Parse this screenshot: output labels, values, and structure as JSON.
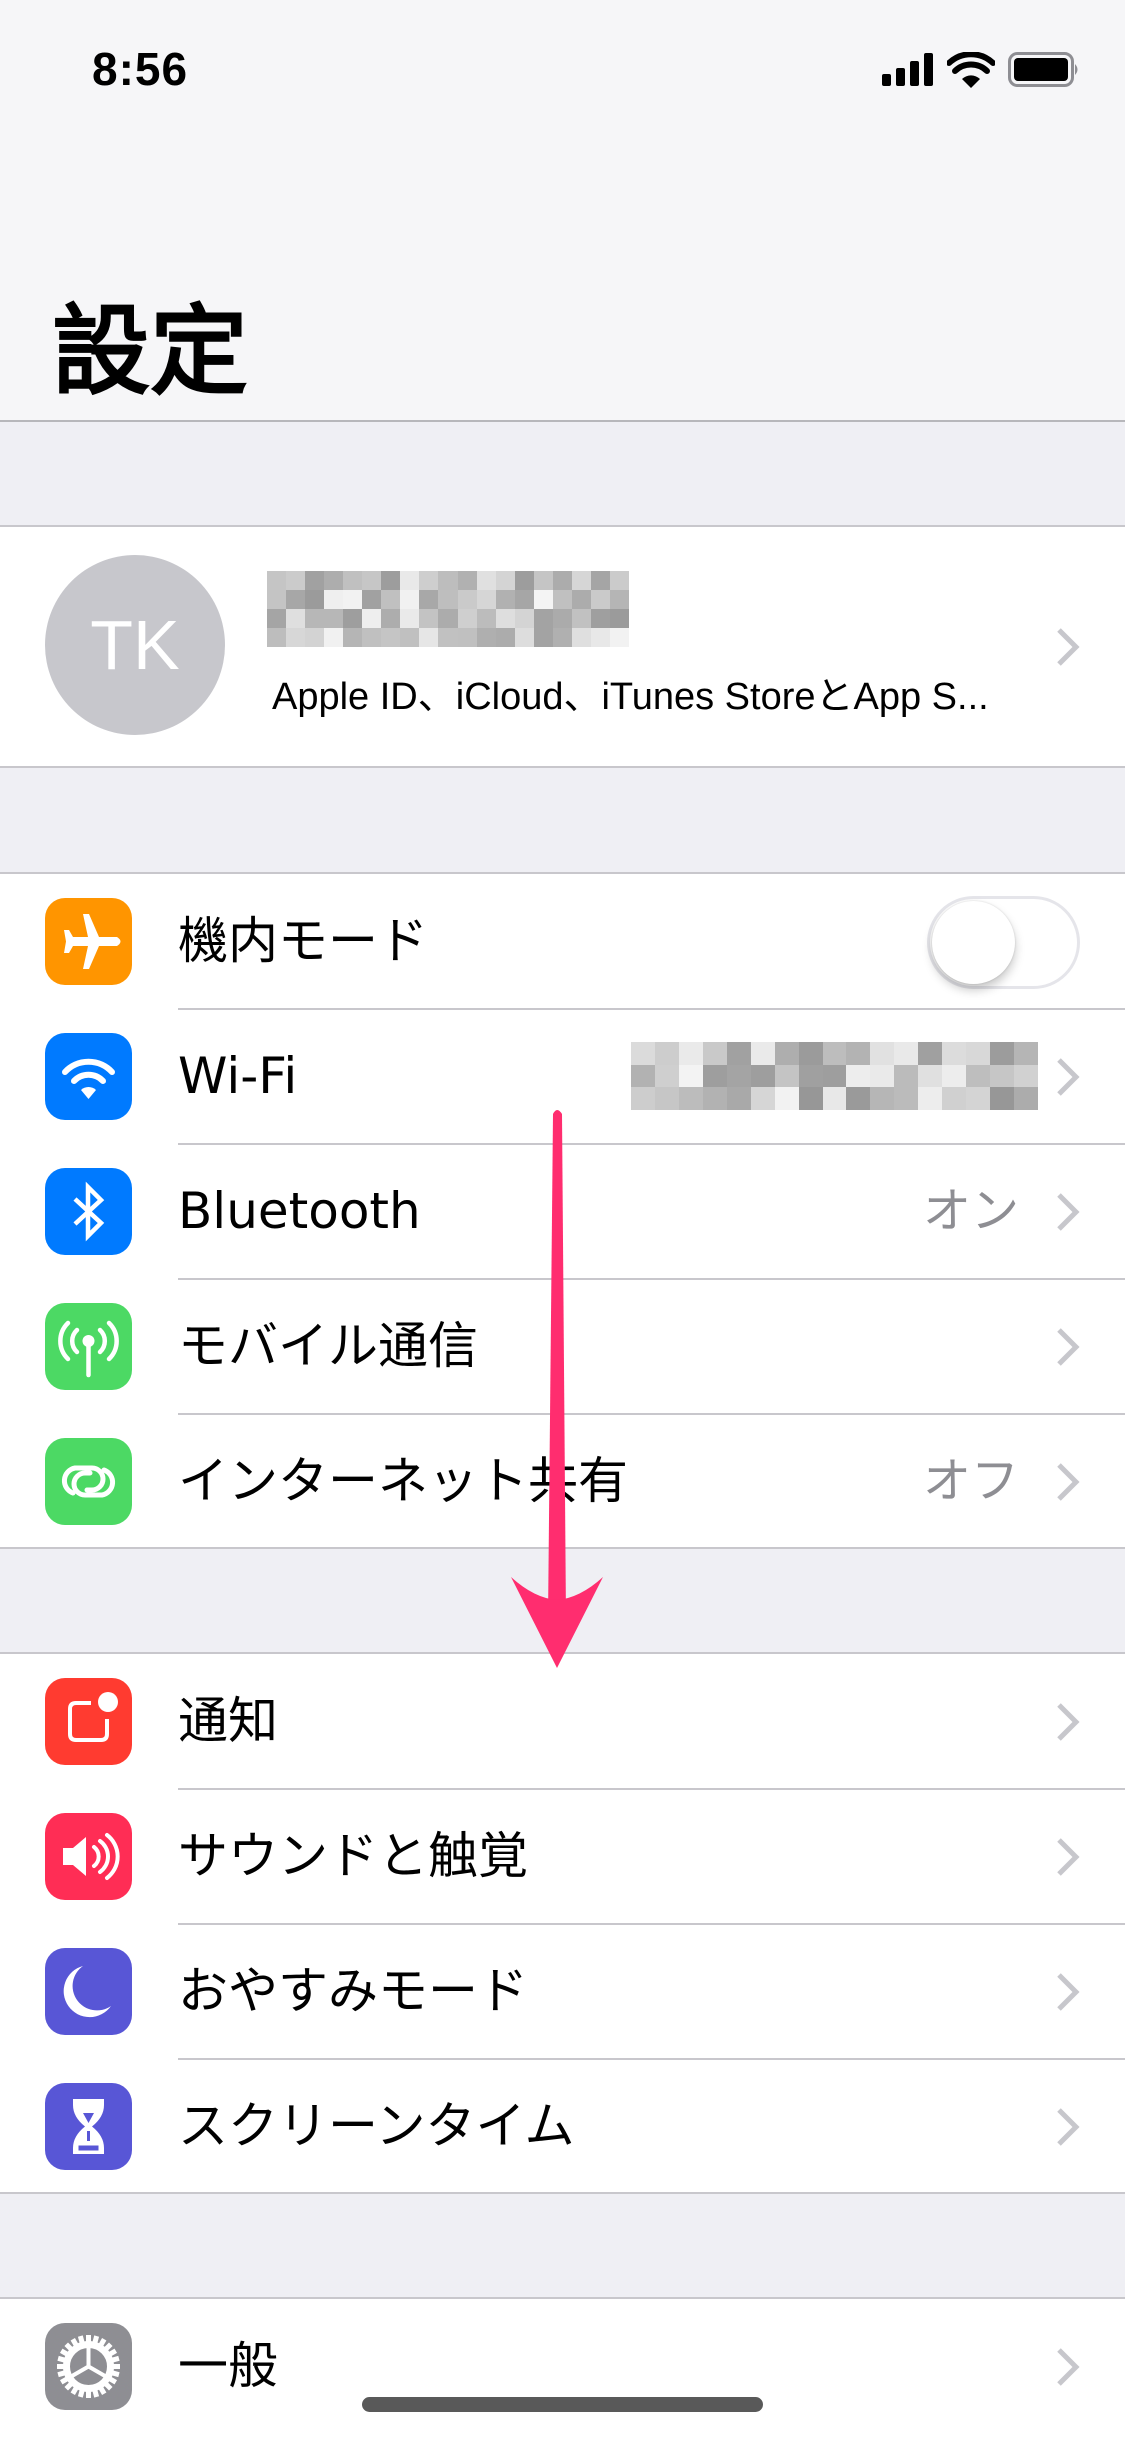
{
  "status_bar": {
    "time": "8:56",
    "signal_icon": "cellular-signal-icon",
    "wifi_icon": "wifi-icon",
    "battery_icon": "battery-full-icon"
  },
  "header": {
    "title": "設定"
  },
  "profile": {
    "initials": "TK",
    "name_redacted": true,
    "subtitle": "Apple ID、iCloud、iTunes StoreとApp S..."
  },
  "sections": [
    {
      "rows": [
        {
          "label": "機内モード",
          "icon": "airplane-icon",
          "color": "#ff9500",
          "control": "toggle",
          "toggle_on": false
        },
        {
          "label": "Wi-Fi",
          "icon": "wifi-icon",
          "color": "#007aff",
          "detail_redacted": true
        },
        {
          "label": "Bluetooth",
          "icon": "bluetooth-icon",
          "color": "#007aff",
          "detail": "オン"
        },
        {
          "label": "モバイル通信",
          "icon": "antenna-icon",
          "color": "#4cd964"
        },
        {
          "label": "インターネット共有",
          "icon": "hotspot-icon",
          "color": "#4cd964",
          "detail": "オフ"
        }
      ]
    },
    {
      "rows": [
        {
          "label": "通知",
          "icon": "notification-icon",
          "color": "#ff3b30"
        },
        {
          "label": "サウンドと触覚",
          "icon": "speaker-icon",
          "color": "#ff2d55"
        },
        {
          "label": "おやすみモード",
          "icon": "moon-icon",
          "color": "#5856d6"
        },
        {
          "label": "スクリーンタイム",
          "icon": "hourglass-icon",
          "color": "#5856d6"
        }
      ]
    },
    {
      "rows": [
        {
          "label": "一般",
          "icon": "gear-icon",
          "color": "#8e8e93"
        }
      ]
    }
  ],
  "annotation": {
    "type": "scroll-down-arrow",
    "color": "#ff2d6f"
  }
}
